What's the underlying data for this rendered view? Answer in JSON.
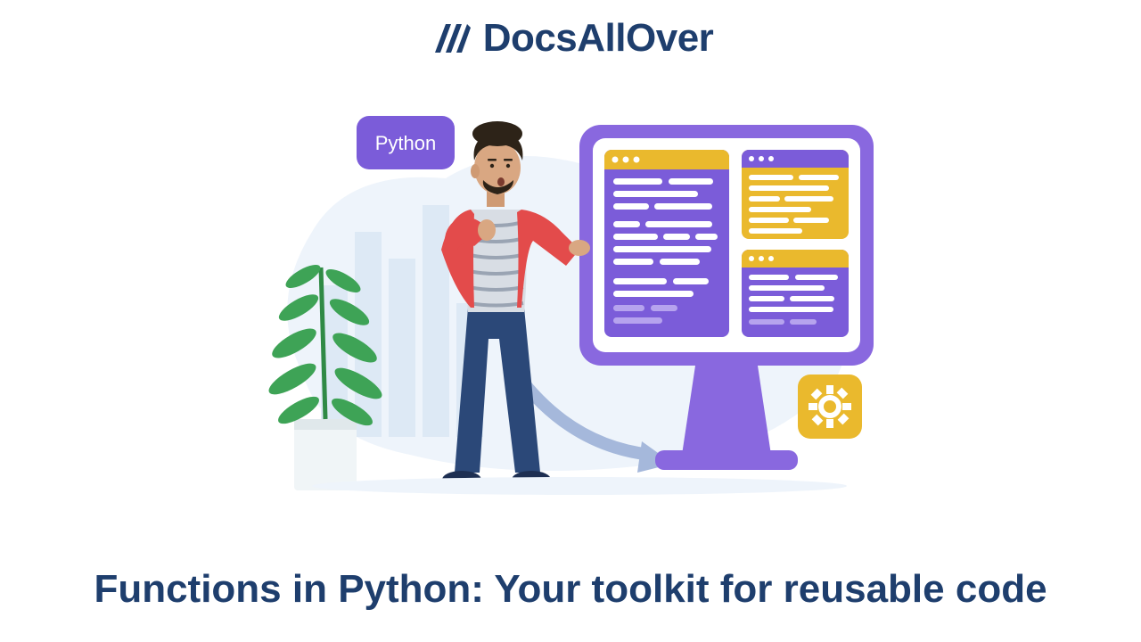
{
  "header": {
    "brand": "DocsAllOver"
  },
  "illustration": {
    "badge_label": "Python"
  },
  "title": "Functions in Python: Your toolkit for reusable code",
  "colors": {
    "navy": "#1e3e6d",
    "purple": "#7b5cd9",
    "purple_light": "#a58ce8",
    "yellow": "#eab92d",
    "red": "#e94e4e",
    "blue_light": "#e8eef7",
    "blue_arrow": "#6d8bc9",
    "skin": "#d9a782",
    "hair": "#2d2318",
    "pants": "#2b4878",
    "shoe": "#1e2f52",
    "plant": "#3ea356",
    "pot": "#e8eef0"
  }
}
